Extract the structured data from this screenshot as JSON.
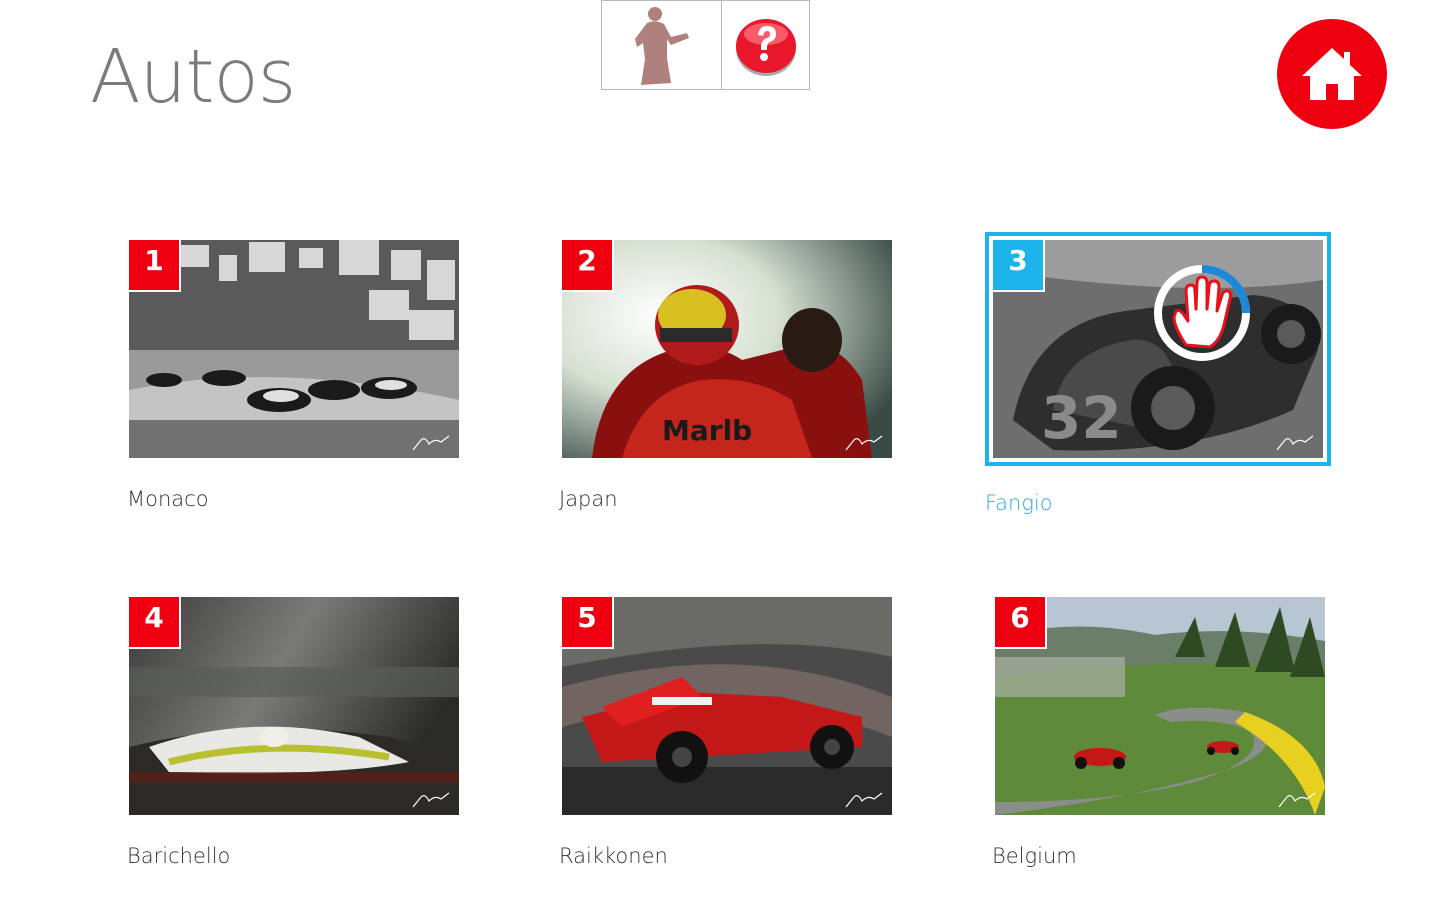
{
  "header": {
    "title": "Autos"
  },
  "tiles": [
    {
      "number": "1",
      "label": "Monaco"
    },
    {
      "number": "2",
      "label": "Japan"
    },
    {
      "number": "3",
      "label": "Fangio",
      "selected": true
    },
    {
      "number": "4",
      "label": "Barichello"
    },
    {
      "number": "5",
      "label": "Raikkonen"
    },
    {
      "number": "6",
      "label": "Belgium"
    }
  ],
  "colors": {
    "accent": "#ee0010",
    "selection": "#1cb4ea",
    "title": "#7b7b7b"
  },
  "icons": {
    "toolbar": [
      "person-silhouette-icon",
      "help-question-icon"
    ],
    "home": "home-icon",
    "cursor": "hand-cursor-icon"
  },
  "cursor_progress": 0.25
}
